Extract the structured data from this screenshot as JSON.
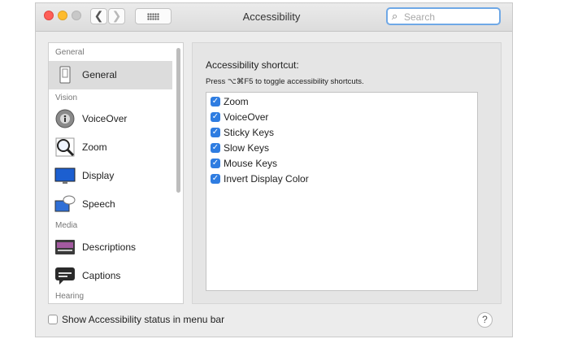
{
  "window": {
    "title": "Accessibility",
    "nav_back_glyph": "❮",
    "nav_forward_glyph": "❯"
  },
  "search": {
    "placeholder": "Search",
    "icon_glyph": "⌕"
  },
  "sidebar": {
    "sections": [
      {
        "label": "General"
      },
      {
        "label": "Vision"
      },
      {
        "label": "Media"
      },
      {
        "label": "Hearing"
      }
    ],
    "items": [
      {
        "label": "General",
        "icon": "general-icon",
        "selected": true
      },
      {
        "label": "VoiceOver",
        "icon": "voiceover-icon"
      },
      {
        "label": "Zoom",
        "icon": "zoom-icon"
      },
      {
        "label": "Display",
        "icon": "display-icon"
      },
      {
        "label": "Speech",
        "icon": "speech-icon"
      },
      {
        "label": "Descriptions",
        "icon": "descriptions-icon"
      },
      {
        "label": "Captions",
        "icon": "captions-icon"
      }
    ]
  },
  "content": {
    "title": "Accessibility shortcut:",
    "hint": "Press ⌥⌘F5 to toggle accessibility shortcuts.",
    "check_glyph": "✓",
    "options": [
      {
        "label": "Zoom",
        "checked": true
      },
      {
        "label": "VoiceOver",
        "checked": true
      },
      {
        "label": "Sticky Keys",
        "checked": true
      },
      {
        "label": "Slow Keys",
        "checked": true
      },
      {
        "label": "Mouse Keys",
        "checked": true
      },
      {
        "label": "Invert Display Color",
        "checked": true
      }
    ]
  },
  "footer": {
    "status_label": "Show Accessibility status in menu bar",
    "status_checked": false,
    "help_glyph": "?"
  },
  "colors": {
    "accent": "#2f7de1",
    "window_bg": "#ececec",
    "selected_row": "#dcdcdc"
  }
}
